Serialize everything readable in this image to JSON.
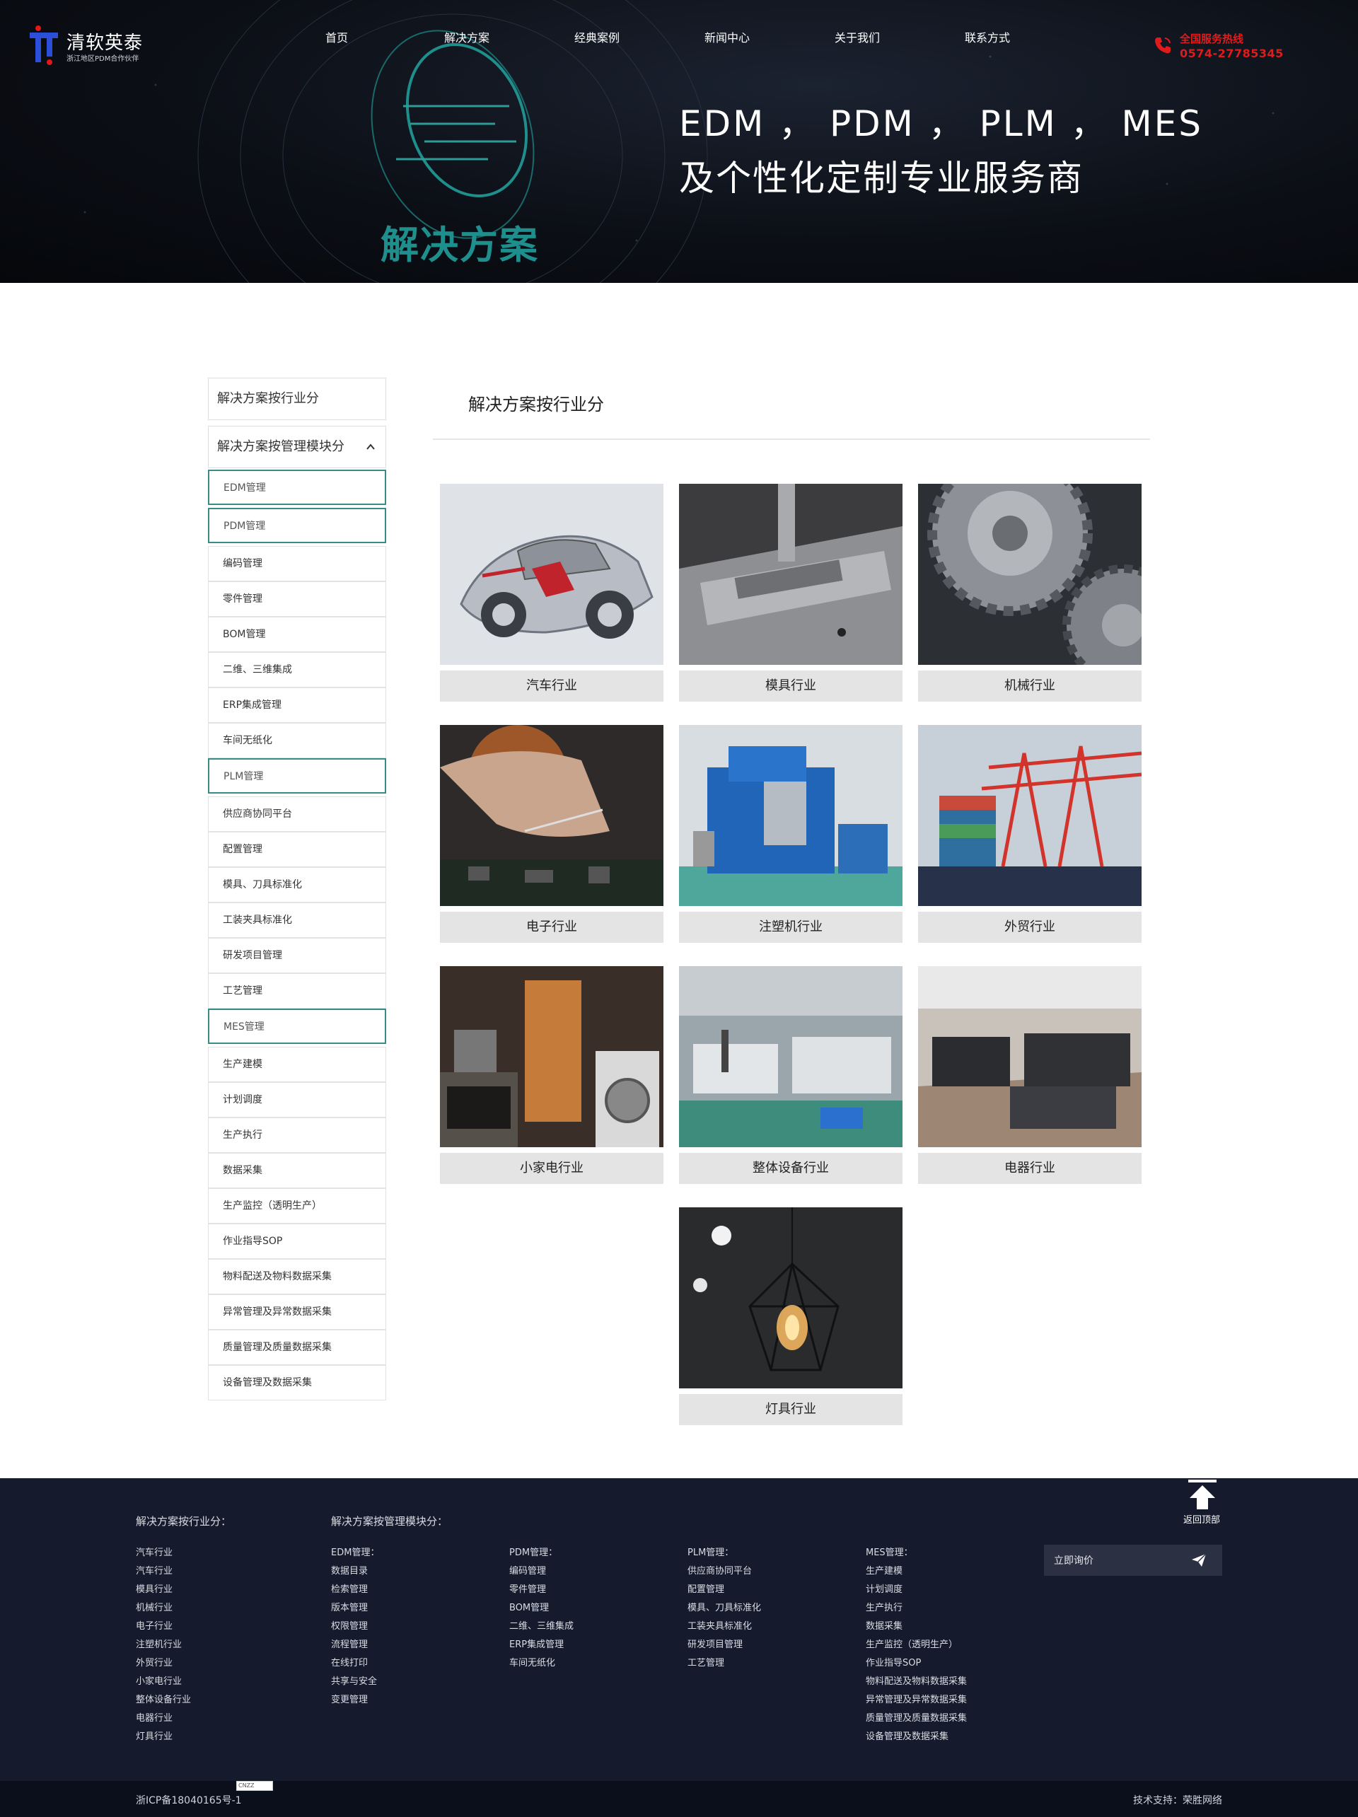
{
  "header": {
    "logo_name": "清软英泰",
    "logo_sub": "浙江地区PDM合作伙伴",
    "nav": [
      "首页",
      "解决方案",
      "经典案例",
      "新闻中心",
      "关于我们",
      "联系方式"
    ],
    "hotline_label": "全国服务热线",
    "hotline_number": "0574-27785345"
  },
  "hero": {
    "line1": "EDM ， PDM ， PLM ， MES",
    "line2": "及个性化定制专业服务商",
    "section_title": "解决方案"
  },
  "sidebar": {
    "group1": "解决方案按行业分",
    "group2": "解决方案按管理模块分",
    "items": [
      {
        "label": "EDM管理",
        "cat": true
      },
      {
        "label": "PDM管理",
        "cat": true
      },
      {
        "label": "编码管理",
        "cat": false
      },
      {
        "label": "零件管理",
        "cat": false
      },
      {
        "label": "BOM管理",
        "cat": false
      },
      {
        "label": "二维、三维集成",
        "cat": false
      },
      {
        "label": "ERP集成管理",
        "cat": false
      },
      {
        "label": "车间无纸化",
        "cat": false
      },
      {
        "label": "PLM管理",
        "cat": true
      },
      {
        "label": "供应商协同平台",
        "cat": false
      },
      {
        "label": "配置管理",
        "cat": false
      },
      {
        "label": "模具、刀具标准化",
        "cat": false
      },
      {
        "label": "工装夹具标准化",
        "cat": false
      },
      {
        "label": "研发项目管理",
        "cat": false
      },
      {
        "label": "工艺管理",
        "cat": false
      },
      {
        "label": "MES管理",
        "cat": true
      },
      {
        "label": "生产建模",
        "cat": false
      },
      {
        "label": "计划调度",
        "cat": false
      },
      {
        "label": "生产执行",
        "cat": false
      },
      {
        "label": "数据采集",
        "cat": false
      },
      {
        "label": "生产监控（透明生产）",
        "cat": false
      },
      {
        "label": "作业指导SOP",
        "cat": false
      },
      {
        "label": "物料配送及物料数据采集",
        "cat": false
      },
      {
        "label": "异常管理及异常数据采集",
        "cat": false
      },
      {
        "label": "质量管理及质量数据采集",
        "cat": false
      },
      {
        "label": "设备管理及数据采集",
        "cat": false
      }
    ]
  },
  "main": {
    "title": "解决方案按行业分",
    "cards": [
      {
        "label": "汽车行业",
        "icon": "car-photo"
      },
      {
        "label": "模具行业",
        "icon": "mold-photo"
      },
      {
        "label": "机械行业",
        "icon": "gear-photo"
      },
      {
        "label": "电子行业",
        "icon": "electronics-photo"
      },
      {
        "label": "注塑机行业",
        "icon": "injection-machine-photo"
      },
      {
        "label": "外贸行业",
        "icon": "port-crane-photo"
      },
      {
        "label": "小家电行业",
        "icon": "kitchen-appliance-photo"
      },
      {
        "label": "整体设备行业",
        "icon": "factory-line-photo"
      },
      {
        "label": "电器行业",
        "icon": "appliance-store-photo"
      },
      {
        "label": "灯具行业",
        "icon": "lamp-photo"
      }
    ]
  },
  "footer": {
    "back_top": "返回顶部",
    "col1_title": "解决方案按行业分：",
    "col1": [
      "汽车行业",
      "汽车行业",
      "模具行业",
      "机械行业",
      "电子行业",
      "注塑机行业",
      "外贸行业",
      "小家电行业",
      "整体设备行业",
      "电器行业",
      "灯具行业"
    ],
    "col2_title": "解决方案按管理模块分：",
    "edm": [
      "EDM管理：",
      "数据目录",
      "检索管理",
      "版本管理",
      "权限管理",
      "流程管理",
      "在线打印",
      "共享与安全",
      "变更管理"
    ],
    "pdm": [
      "PDM管理：",
      "编码管理",
      "零件管理",
      "BOM管理",
      "二维、三维集成",
      "ERP集成管理",
      "车间无纸化"
    ],
    "plm": [
      "PLM管理：",
      "供应商协同平台",
      "配置管理",
      "模具、刀具标准化",
      "工装夹具标准化",
      "研发项目管理",
      "工艺管理"
    ],
    "mes": [
      "MES管理：",
      "生产建模",
      "计划调度",
      "生产执行",
      "数据采集",
      "生产监控（透明生产）",
      "作业指导SOP",
      "物料配送及物料数据采集",
      "异常管理及异常数据采集",
      "质量管理及质量数据采集",
      "设备管理及数据采集"
    ],
    "inquiry": "立即询价",
    "icp": "浙ICP备18040165号-1",
    "cnzz": "CNZZ",
    "tech_support": "技术支持：荣胜网络"
  },
  "colors": {
    "accent_teal": "#3a8d86",
    "hotline_red": "#e11b1b",
    "footer_bg": "#151b2c"
  }
}
